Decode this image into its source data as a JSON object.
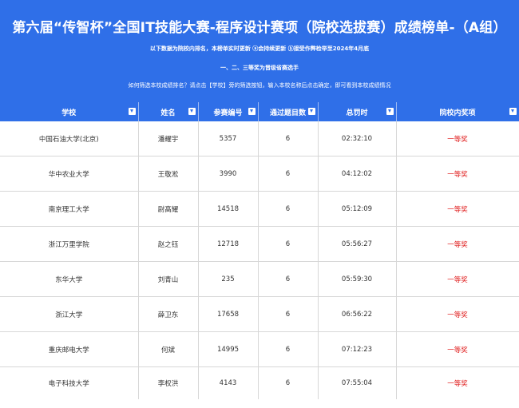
{
  "title": "第六届“传智杯”全国IT技能大赛-程序设计赛项（院校选拔赛）成绩榜单-（A组）",
  "notes": {
    "line1": "以下数据为院校内排名，本榜单实时更新  ⓐ会持续更新  ⓑ接受作弊检举至2024年4月底",
    "line2": "一、二、三等奖为晋级省赛选手",
    "line3": "如何筛选本校成绩排名？请点击【学校】旁的筛选按钮，输入本校名称后点击确定，即可看到本校成绩情况"
  },
  "columns": [
    "学校",
    "姓名",
    "参赛编号",
    "通过题目数",
    "总罚时",
    "院校内奖项"
  ],
  "rows": [
    [
      "中国石油大学(北京)",
      "潘耀宇",
      "5357",
      "6",
      "02:32:10",
      "一等奖"
    ],
    [
      "华中农业大学",
      "王敬淞",
      "3990",
      "6",
      "04:12:02",
      "一等奖"
    ],
    [
      "南京理工大学",
      "尉高耀",
      "14518",
      "6",
      "05:12:09",
      "一等奖"
    ],
    [
      "浙江万里学院",
      "赵之钰",
      "12718",
      "6",
      "05:56:27",
      "一等奖"
    ],
    [
      "东华大学",
      "刘青山",
      "235",
      "6",
      "05:59:30",
      "一等奖"
    ],
    [
      "浙江大学",
      "薛卫东",
      "17658",
      "6",
      "06:56:22",
      "一等奖"
    ],
    [
      "重庆邮电大学",
      "何斌",
      "14995",
      "6",
      "07:12:23",
      "一等奖"
    ],
    [
      "电子科技大学",
      "李权洪",
      "4143",
      "6",
      "07:55:04",
      "一等奖"
    ]
  ],
  "colors": {
    "header_blue": "#2f6fe8",
    "award_red": "#e02020"
  }
}
